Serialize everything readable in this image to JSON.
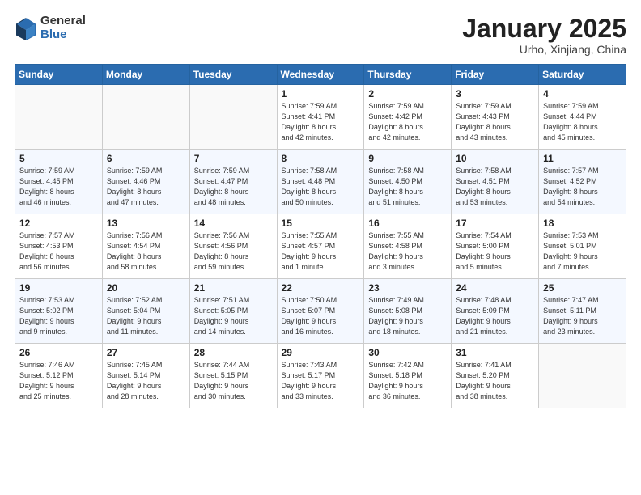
{
  "header": {
    "logo_general": "General",
    "logo_blue": "Blue",
    "month_title": "January 2025",
    "location": "Urho, Xinjiang, China"
  },
  "weekdays": [
    "Sunday",
    "Monday",
    "Tuesday",
    "Wednesday",
    "Thursday",
    "Friday",
    "Saturday"
  ],
  "weeks": [
    [
      {
        "day": "",
        "info": ""
      },
      {
        "day": "",
        "info": ""
      },
      {
        "day": "",
        "info": ""
      },
      {
        "day": "1",
        "info": "Sunrise: 7:59 AM\nSunset: 4:41 PM\nDaylight: 8 hours\nand 42 minutes."
      },
      {
        "day": "2",
        "info": "Sunrise: 7:59 AM\nSunset: 4:42 PM\nDaylight: 8 hours\nand 42 minutes."
      },
      {
        "day": "3",
        "info": "Sunrise: 7:59 AM\nSunset: 4:43 PM\nDaylight: 8 hours\nand 43 minutes."
      },
      {
        "day": "4",
        "info": "Sunrise: 7:59 AM\nSunset: 4:44 PM\nDaylight: 8 hours\nand 45 minutes."
      }
    ],
    [
      {
        "day": "5",
        "info": "Sunrise: 7:59 AM\nSunset: 4:45 PM\nDaylight: 8 hours\nand 46 minutes."
      },
      {
        "day": "6",
        "info": "Sunrise: 7:59 AM\nSunset: 4:46 PM\nDaylight: 8 hours\nand 47 minutes."
      },
      {
        "day": "7",
        "info": "Sunrise: 7:59 AM\nSunset: 4:47 PM\nDaylight: 8 hours\nand 48 minutes."
      },
      {
        "day": "8",
        "info": "Sunrise: 7:58 AM\nSunset: 4:48 PM\nDaylight: 8 hours\nand 50 minutes."
      },
      {
        "day": "9",
        "info": "Sunrise: 7:58 AM\nSunset: 4:50 PM\nDaylight: 8 hours\nand 51 minutes."
      },
      {
        "day": "10",
        "info": "Sunrise: 7:58 AM\nSunset: 4:51 PM\nDaylight: 8 hours\nand 53 minutes."
      },
      {
        "day": "11",
        "info": "Sunrise: 7:57 AM\nSunset: 4:52 PM\nDaylight: 8 hours\nand 54 minutes."
      }
    ],
    [
      {
        "day": "12",
        "info": "Sunrise: 7:57 AM\nSunset: 4:53 PM\nDaylight: 8 hours\nand 56 minutes."
      },
      {
        "day": "13",
        "info": "Sunrise: 7:56 AM\nSunset: 4:54 PM\nDaylight: 8 hours\nand 58 minutes."
      },
      {
        "day": "14",
        "info": "Sunrise: 7:56 AM\nSunset: 4:56 PM\nDaylight: 8 hours\nand 59 minutes."
      },
      {
        "day": "15",
        "info": "Sunrise: 7:55 AM\nSunset: 4:57 PM\nDaylight: 9 hours\nand 1 minute."
      },
      {
        "day": "16",
        "info": "Sunrise: 7:55 AM\nSunset: 4:58 PM\nDaylight: 9 hours\nand 3 minutes."
      },
      {
        "day": "17",
        "info": "Sunrise: 7:54 AM\nSunset: 5:00 PM\nDaylight: 9 hours\nand 5 minutes."
      },
      {
        "day": "18",
        "info": "Sunrise: 7:53 AM\nSunset: 5:01 PM\nDaylight: 9 hours\nand 7 minutes."
      }
    ],
    [
      {
        "day": "19",
        "info": "Sunrise: 7:53 AM\nSunset: 5:02 PM\nDaylight: 9 hours\nand 9 minutes."
      },
      {
        "day": "20",
        "info": "Sunrise: 7:52 AM\nSunset: 5:04 PM\nDaylight: 9 hours\nand 11 minutes."
      },
      {
        "day": "21",
        "info": "Sunrise: 7:51 AM\nSunset: 5:05 PM\nDaylight: 9 hours\nand 14 minutes."
      },
      {
        "day": "22",
        "info": "Sunrise: 7:50 AM\nSunset: 5:07 PM\nDaylight: 9 hours\nand 16 minutes."
      },
      {
        "day": "23",
        "info": "Sunrise: 7:49 AM\nSunset: 5:08 PM\nDaylight: 9 hours\nand 18 minutes."
      },
      {
        "day": "24",
        "info": "Sunrise: 7:48 AM\nSunset: 5:09 PM\nDaylight: 9 hours\nand 21 minutes."
      },
      {
        "day": "25",
        "info": "Sunrise: 7:47 AM\nSunset: 5:11 PM\nDaylight: 9 hours\nand 23 minutes."
      }
    ],
    [
      {
        "day": "26",
        "info": "Sunrise: 7:46 AM\nSunset: 5:12 PM\nDaylight: 9 hours\nand 25 minutes."
      },
      {
        "day": "27",
        "info": "Sunrise: 7:45 AM\nSunset: 5:14 PM\nDaylight: 9 hours\nand 28 minutes."
      },
      {
        "day": "28",
        "info": "Sunrise: 7:44 AM\nSunset: 5:15 PM\nDaylight: 9 hours\nand 30 minutes."
      },
      {
        "day": "29",
        "info": "Sunrise: 7:43 AM\nSunset: 5:17 PM\nDaylight: 9 hours\nand 33 minutes."
      },
      {
        "day": "30",
        "info": "Sunrise: 7:42 AM\nSunset: 5:18 PM\nDaylight: 9 hours\nand 36 minutes."
      },
      {
        "day": "31",
        "info": "Sunrise: 7:41 AM\nSunset: 5:20 PM\nDaylight: 9 hours\nand 38 minutes."
      },
      {
        "day": "",
        "info": ""
      }
    ]
  ]
}
